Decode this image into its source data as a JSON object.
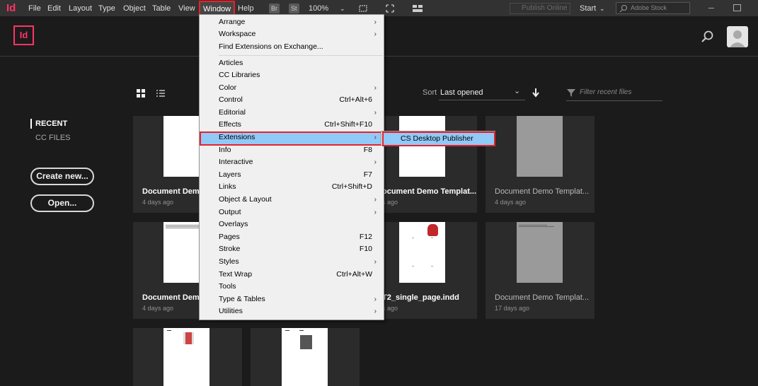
{
  "menubar": {
    "logo": "Id",
    "items": [
      "File",
      "Edit",
      "Layout",
      "Type",
      "Object",
      "Table",
      "View",
      "Window",
      "Help"
    ],
    "badges": [
      "Br",
      "St"
    ],
    "zoom": "100%",
    "publish_online": "Publish Online",
    "workspace": "Start",
    "stock_search_placeholder": "Adobe Stock"
  },
  "app": {
    "logo": "Id",
    "nav": {
      "recent": "RECENT",
      "cc_files": "CC FILES"
    },
    "create_new": "Create new...",
    "open": "Open...",
    "sort_label": "Sort",
    "sort_value": "Last opened",
    "filter_placeholder": "Filter recent files"
  },
  "cards": [
    {
      "title": "Document Demo",
      "date": "4 days ago"
    },
    {
      "title": "ocument Demo Templat...",
      "date": "s ago"
    },
    {
      "title": "Document Demo Templat...",
      "date": "4 days ago"
    },
    {
      "title": "Document Demo",
      "date": "4 days ago"
    },
    {
      "title": "T2_single_page.indd",
      "date": "s ago"
    },
    {
      "title": "Document Demo Templat...",
      "date": "17 days ago"
    }
  ],
  "window_menu": [
    {
      "label": "Arrange",
      "shortcut": "",
      "submenu": true
    },
    {
      "label": "Workspace",
      "shortcut": "",
      "submenu": true
    },
    {
      "label": "Find Extensions on Exchange...",
      "shortcut": "",
      "submenu": false
    },
    {
      "label": "Articles",
      "shortcut": "",
      "submenu": false
    },
    {
      "label": "CC Libraries",
      "shortcut": "",
      "submenu": false
    },
    {
      "label": "Color",
      "shortcut": "",
      "submenu": true
    },
    {
      "label": "Control",
      "shortcut": "Ctrl+Alt+6",
      "submenu": false
    },
    {
      "label": "Editorial",
      "shortcut": "",
      "submenu": true
    },
    {
      "label": "Effects",
      "shortcut": "Ctrl+Shift+F10",
      "submenu": false
    },
    {
      "label": "Extensions",
      "shortcut": "",
      "submenu": true
    },
    {
      "label": "Info",
      "shortcut": "F8",
      "submenu": false
    },
    {
      "label": "Interactive",
      "shortcut": "",
      "submenu": true
    },
    {
      "label": "Layers",
      "shortcut": "F7",
      "submenu": false
    },
    {
      "label": "Links",
      "shortcut": "Ctrl+Shift+D",
      "submenu": false
    },
    {
      "label": "Object & Layout",
      "shortcut": "",
      "submenu": true
    },
    {
      "label": "Output",
      "shortcut": "",
      "submenu": true
    },
    {
      "label": "Overlays",
      "shortcut": "",
      "submenu": false
    },
    {
      "label": "Pages",
      "shortcut": "F12",
      "submenu": false
    },
    {
      "label": "Stroke",
      "shortcut": "F10",
      "submenu": false
    },
    {
      "label": "Styles",
      "shortcut": "",
      "submenu": true
    },
    {
      "label": "Text Wrap",
      "shortcut": "Ctrl+Alt+W",
      "submenu": false
    },
    {
      "label": "Tools",
      "shortcut": "",
      "submenu": false
    },
    {
      "label": "Type & Tables",
      "shortcut": "",
      "submenu": true
    },
    {
      "label": "Utilities",
      "shortcut": "",
      "submenu": true
    }
  ],
  "extensions_submenu": [
    "CS Desktop Publisher"
  ]
}
